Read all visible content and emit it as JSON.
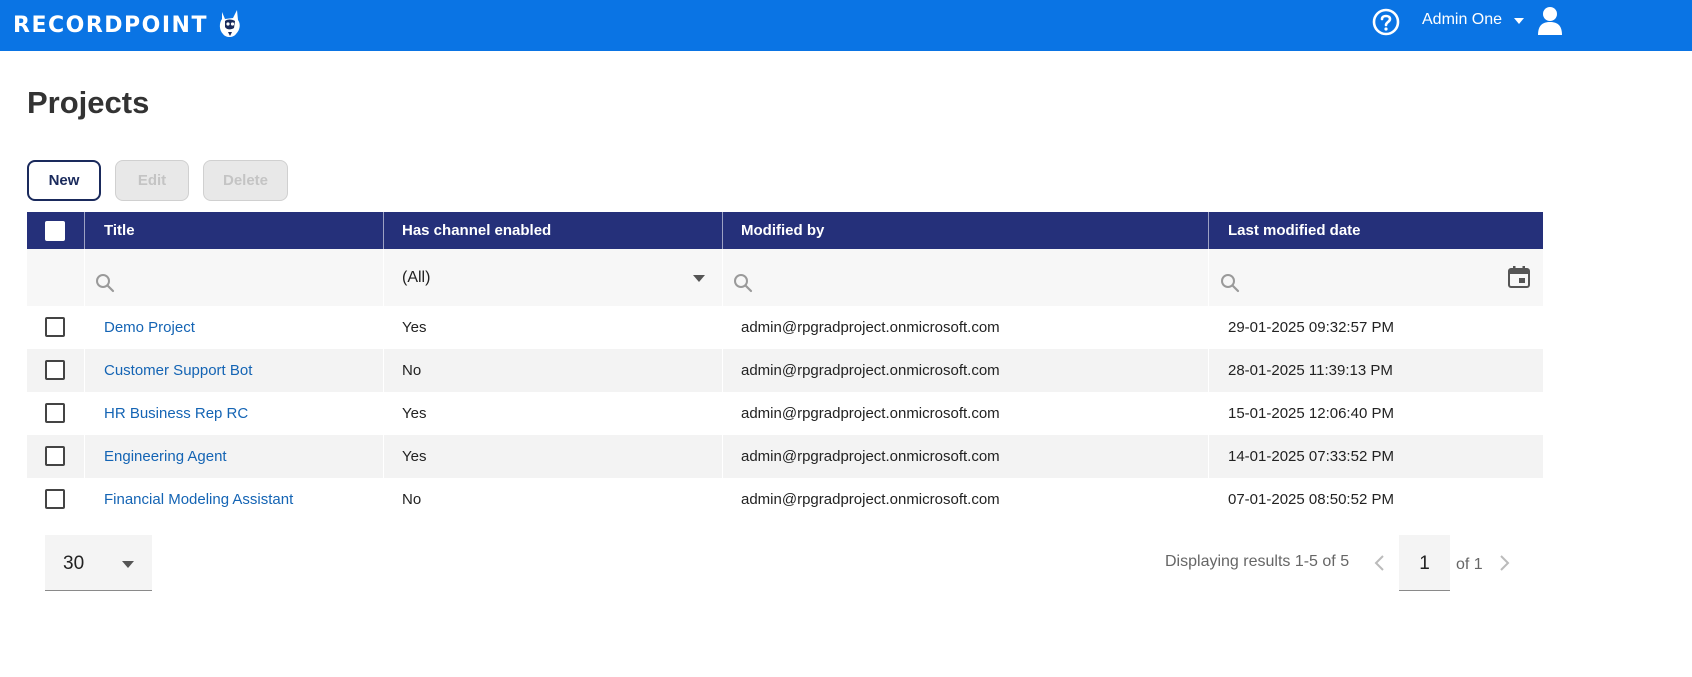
{
  "header": {
    "brand": "RECORDPOINT",
    "user_name": "Admin One",
    "bg_color": "#0a74e4",
    "icons": [
      "help-icon",
      "caret-down-icon",
      "user-icon"
    ]
  },
  "page": {
    "title": "Projects"
  },
  "toolbar": {
    "new_label": "New",
    "edit_label": "Edit",
    "delete_label": "Delete"
  },
  "table": {
    "header_color": "#25307a",
    "columns": [
      "Title",
      "Has channel enabled",
      "Modified by",
      "Last modified date"
    ],
    "filters": {
      "has_channel_value": "(All)"
    },
    "rows": [
      {
        "title": "Demo Project",
        "has_channel": "Yes",
        "modified_by": "admin@rpgradproject.onmicrosoft.com",
        "modified_date": "29-01-2025 09:32:57 PM"
      },
      {
        "title": "Customer Support Bot",
        "has_channel": "No",
        "modified_by": "admin@rpgradproject.onmicrosoft.com",
        "modified_date": "28-01-2025 11:39:13 PM"
      },
      {
        "title": "HR Business Rep RC",
        "has_channel": "Yes",
        "modified_by": "admin@rpgradproject.onmicrosoft.com",
        "modified_date": "15-01-2025 12:06:40 PM"
      },
      {
        "title": "Engineering Agent",
        "has_channel": "Yes",
        "modified_by": "admin@rpgradproject.onmicrosoft.com",
        "modified_date": "14-01-2025 07:33:52 PM"
      },
      {
        "title": "Financial Modeling Assistant",
        "has_channel": "No",
        "modified_by": "admin@rpgradproject.onmicrosoft.com",
        "modified_date": "07-01-2025 08:50:52 PM"
      }
    ]
  },
  "footer": {
    "page_size": "30",
    "results_text": "Displaying results 1-5 of 5",
    "current_page": "1",
    "of_text": "of 1"
  }
}
